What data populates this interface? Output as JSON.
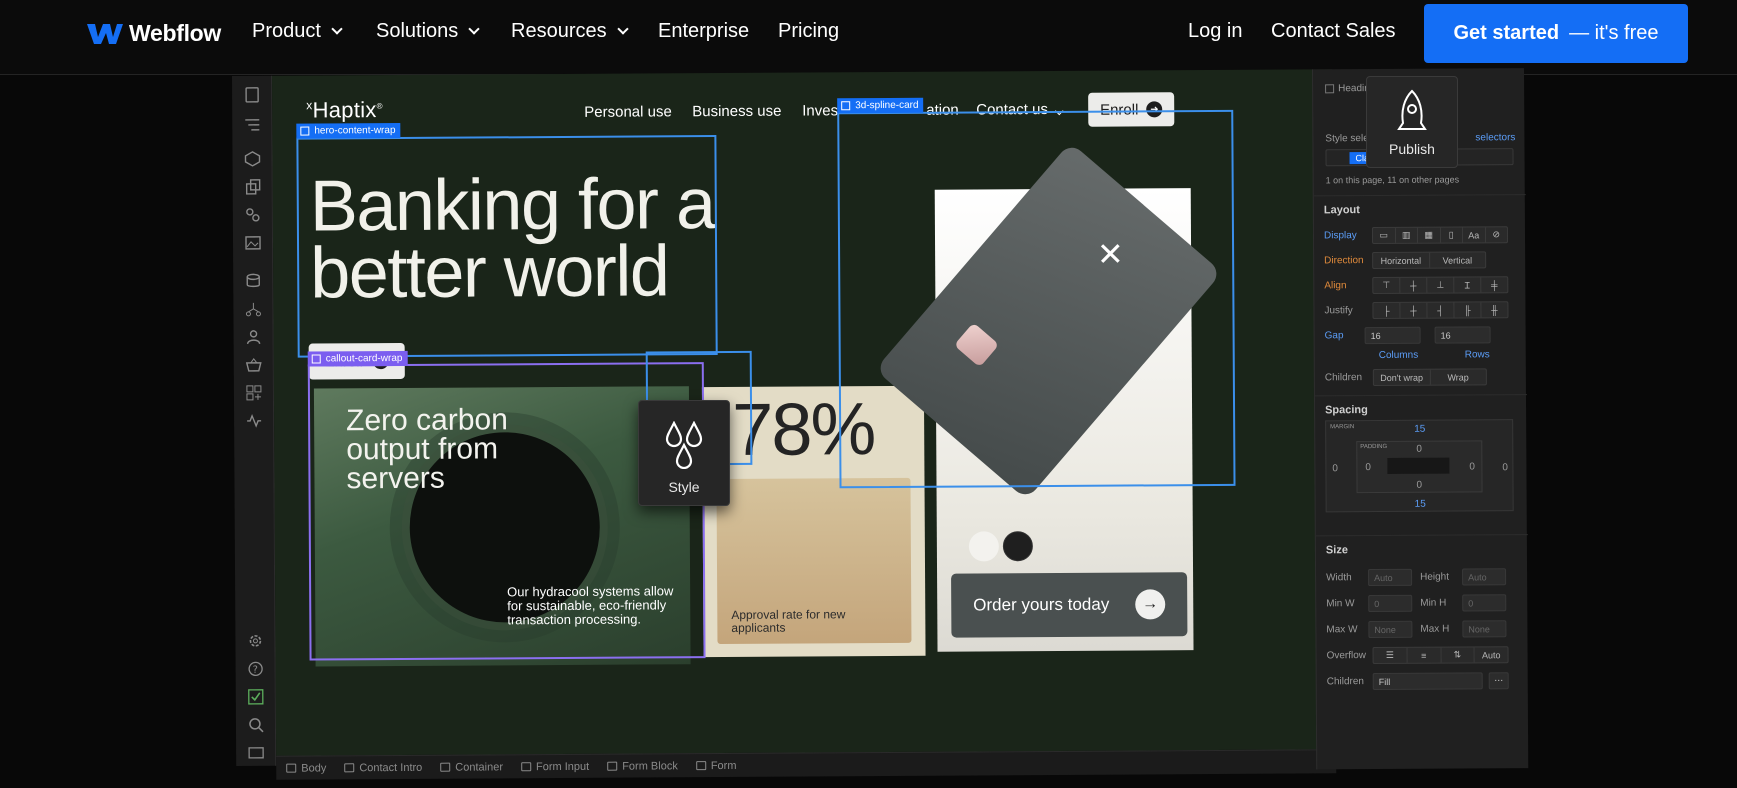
{
  "topnav": {
    "brand": "Webflow",
    "items": [
      {
        "label": "Product",
        "has_menu": true
      },
      {
        "label": "Solutions",
        "has_menu": true
      },
      {
        "label": "Resources",
        "has_menu": true
      },
      {
        "label": "Enterprise",
        "has_menu": false
      },
      {
        "label": "Pricing",
        "has_menu": false
      }
    ],
    "login": "Log in",
    "contact": "Contact Sales",
    "cta_main": "Get started",
    "cta_sub": "— it's free",
    "cta_color": "#146ef5"
  },
  "site": {
    "logo": "Haptix",
    "nav": [
      "Personal use",
      "Business use",
      "Inves",
      "ation",
      "Contact us"
    ],
    "enroll": "Enroll",
    "hero_title": "Banking for a better world",
    "hero_enroll": "Enroll",
    "callout_title": "Zero carbon output from servers",
    "callout_desc": "Our hydracool systems allow for sustainable, eco-friendly transaction processing.",
    "stat": "78%",
    "stat_label": "Approval rate for new applicants",
    "order_cta": "Order yours today",
    "swatches": [
      "#f3f2ee",
      "#1f1f1f"
    ]
  },
  "selections": {
    "hero": "hero-content-wrap",
    "callout": "callout-card-wrap",
    "spline": "3d-spline-card"
  },
  "popups": {
    "style": "Style",
    "publish": "Publish"
  },
  "breadcrumbs": [
    "Body",
    "Contact Intro",
    "Container",
    "Form Input",
    "Form Block",
    "Form"
  ],
  "panel": {
    "heading_label": "Heading",
    "style_selector": "Style selector",
    "selectors_link": "selectors",
    "class_name": "Class Name",
    "usage": "1 on this page, 11 on other pages",
    "layout": {
      "title": "Layout",
      "display": "Display",
      "direction": "Direction",
      "direction_options": [
        "Horizontal",
        "Vertical"
      ],
      "align": "Align",
      "justify": "Justify",
      "gap": "Gap",
      "gap_columns": "16",
      "gap_rows": "16",
      "gap_unit": "PX",
      "columns": "Columns",
      "rows": "Rows",
      "children": "Children",
      "children_options": [
        "Don't wrap",
        "Wrap"
      ]
    },
    "spacing": {
      "title": "Spacing",
      "margin_label": "MARGIN",
      "padding_label": "PADDING",
      "margin_top": "15",
      "margin_bottom": "15",
      "margin_left": "0",
      "margin_right": "0",
      "padding_top": "0",
      "padding_bottom": "0",
      "padding_left": "0",
      "padding_right": "0"
    },
    "size": {
      "title": "Size",
      "width": "Width",
      "width_val": "Auto",
      "height": "Height",
      "height_val": "Auto",
      "min_w": "Min W",
      "min_w_val": "0",
      "min_h": "Min H",
      "min_h_val": "0",
      "max_w": "Max W",
      "max_w_val": "None",
      "max_h": "Max H",
      "max_h_val": "None",
      "unit": "PX",
      "overflow": "Overflow",
      "overflow_auto": "Auto",
      "children": "Children",
      "children_val": "Fill"
    }
  }
}
